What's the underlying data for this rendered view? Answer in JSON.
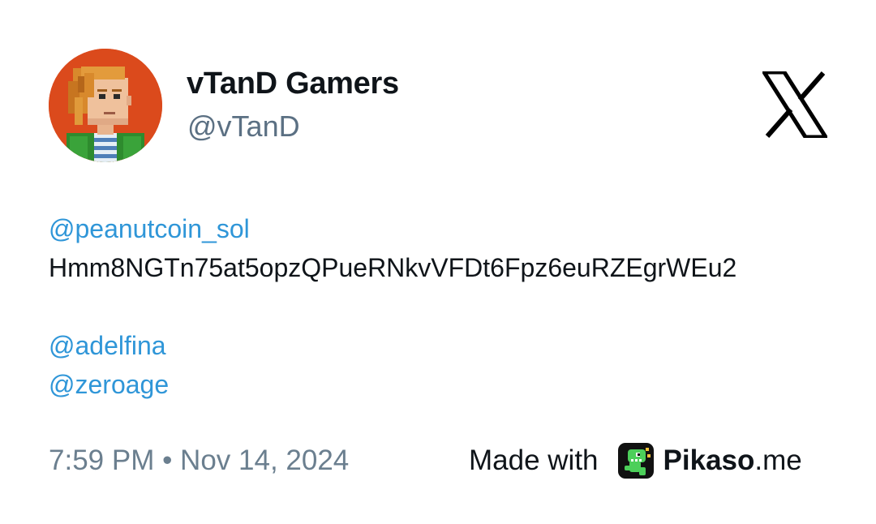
{
  "author": {
    "display_name": "vTanD Gamers",
    "handle": "@vTanD",
    "avatar_icon": "pixel-character-avatar"
  },
  "platform_icon": "x-logo-icon",
  "tweet": {
    "lines": [
      {
        "text": "@peanutcoin_sol",
        "kind": "mention"
      },
      {
        "text": "Hmm8NGTn75at5opzQPueRNkvVFDt6Fpz6euRZEgrWEu2",
        "kind": "text"
      },
      {
        "text": "",
        "kind": "blank"
      },
      {
        "text": "@adelfina",
        "kind": "mention"
      },
      {
        "text": "@zeroage",
        "kind": "mention"
      }
    ]
  },
  "timestamp": "7:59 PM • Nov 14, 2024",
  "credit": {
    "prefix": "Made with",
    "brand": "Pikaso",
    "tld": ".me",
    "logo_icon": "pikaso-dino-logo-icon"
  },
  "colors": {
    "mention": "#2f96d8",
    "muted": "#6b7f8f",
    "text": "#0f1419",
    "avatar_bg": "#db4a1c"
  }
}
